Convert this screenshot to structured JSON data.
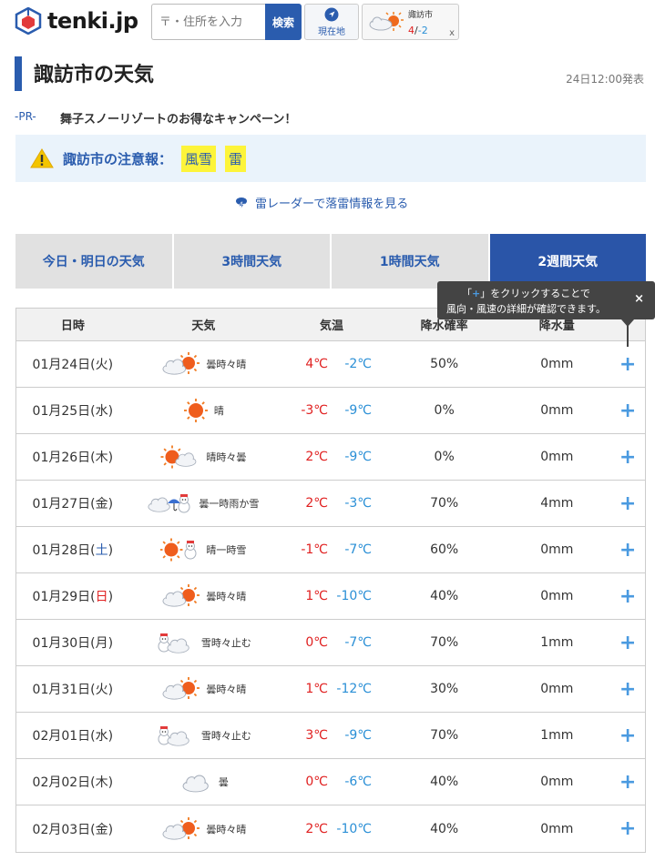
{
  "header": {
    "logo_text": "tenki.jp",
    "search_placeholder": "〒・住所を入力",
    "search_button": "検索",
    "location_button": "現在地",
    "history_city": "諏訪市",
    "history_hi": "4",
    "history_sep": "/",
    "history_lo": "-2",
    "history_close": "x"
  },
  "page": {
    "title": "諏訪市の天気",
    "published": "24日12:00発表",
    "pr_label": "-PR-",
    "pr_text": "舞子スノーリゾートのお得なキャンペーン！",
    "warning_label": "諏訪市の注意報：",
    "warnings": [
      "風雪",
      "雷"
    ],
    "radar_link": "雷レーダーで落雷情報を見る"
  },
  "tabs": [
    "今日・明日の天気",
    "3時間天気",
    "1時間天気",
    "2週間天気"
  ],
  "table": {
    "headers": [
      "日時",
      "天気",
      "気温",
      "降水確率",
      "降水量"
    ],
    "rows": [
      {
        "date": "01月24日(",
        "dow": "火",
        "dow_type": "",
        "icon": "cloudy-sunny",
        "weather": "曇時々晴",
        "hi": "4℃",
        "lo": "-2℃",
        "prob": "50%",
        "prec": "0mm"
      },
      {
        "date": "01月25日(",
        "dow": "水",
        "dow_type": "",
        "icon": "sunny",
        "weather": "晴",
        "hi": "-3℃",
        "lo": "-9℃",
        "prob": "0%",
        "prec": "0mm"
      },
      {
        "date": "01月26日(",
        "dow": "木",
        "dow_type": "",
        "icon": "sunny-cloudy",
        "weather": "晴時々曇",
        "hi": "2℃",
        "lo": "-9℃",
        "prob": "0%",
        "prec": "0mm"
      },
      {
        "date": "01月27日(",
        "dow": "金",
        "dow_type": "",
        "icon": "cloudy-rain-snow",
        "weather": "曇一時雨か雪",
        "hi": "2℃",
        "lo": "-3℃",
        "prob": "70%",
        "prec": "4mm"
      },
      {
        "date": "01月28日(",
        "dow": "土",
        "dow_type": "sat",
        "icon": "sunny-snow",
        "weather": "晴一時雪",
        "hi": "-1℃",
        "lo": "-7℃",
        "prob": "60%",
        "prec": "0mm"
      },
      {
        "date": "01月29日(",
        "dow": "日",
        "dow_type": "sun",
        "icon": "cloudy-sunny",
        "weather": "曇時々晴",
        "hi": "1℃",
        "lo": "-10℃",
        "prob": "40%",
        "prec": "0mm"
      },
      {
        "date": "01月30日(",
        "dow": "月",
        "dow_type": "",
        "icon": "snow-cloudy",
        "weather": "雪時々止む",
        "hi": "0℃",
        "lo": "-7℃",
        "prob": "70%",
        "prec": "1mm"
      },
      {
        "date": "01月31日(",
        "dow": "火",
        "dow_type": "",
        "icon": "cloudy-sunny",
        "weather": "曇時々晴",
        "hi": "1℃",
        "lo": "-12℃",
        "prob": "30%",
        "prec": "0mm"
      },
      {
        "date": "02月01日(",
        "dow": "水",
        "dow_type": "",
        "icon": "snow-cloudy",
        "weather": "雪時々止む",
        "hi": "3℃",
        "lo": "-9℃",
        "prob": "70%",
        "prec": "1mm"
      },
      {
        "date": "02月02日(",
        "dow": "木",
        "dow_type": "",
        "icon": "cloudy",
        "weather": "曇",
        "hi": "0℃",
        "lo": "-6℃",
        "prob": "40%",
        "prec": "0mm"
      },
      {
        "date": "02月03日(",
        "dow": "金",
        "dow_type": "",
        "icon": "cloudy-sunny",
        "weather": "曇時々晴",
        "hi": "2℃",
        "lo": "-10℃",
        "prob": "40%",
        "prec": "0mm"
      }
    ],
    "detail_symbol": "+"
  },
  "tooltip": {
    "line1_pre": "「",
    "line1_plus": "+",
    "line1_post": "」をクリックすることで",
    "line2": "風向・風速の詳細が確認できます。",
    "close": "×"
  },
  "colors": {
    "brand": "#2a5cae",
    "hi_temp": "#e02020",
    "lo_temp": "#2a8fd6",
    "warn_bg": "#eaf3fb",
    "warn_tag": "#fdf43a"
  }
}
